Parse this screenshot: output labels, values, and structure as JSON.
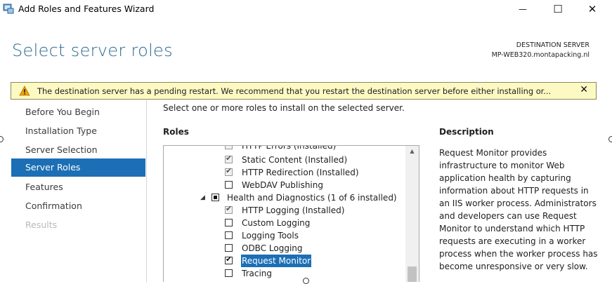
{
  "window": {
    "title": "Add Roles and Features Wizard",
    "minimize_glyph": "—",
    "maximize_glyph": "☐",
    "close_glyph": "✕"
  },
  "header": {
    "page_title": "Select server roles",
    "destination_label": "DESTINATION SERVER",
    "destination_name": "MP-WEB320.montapacking.nl"
  },
  "warning": {
    "icon": "warning-triangle-icon",
    "text": "The destination server has a pending restart. We recommend that you restart the destination server before either installing or...",
    "close_glyph": "✕"
  },
  "nav": {
    "items": [
      {
        "label": "Before You Begin",
        "state": "normal"
      },
      {
        "label": "Installation Type",
        "state": "normal"
      },
      {
        "label": "Server Selection",
        "state": "normal"
      },
      {
        "label": "Server Roles",
        "state": "selected"
      },
      {
        "label": "Features",
        "state": "normal"
      },
      {
        "label": "Confirmation",
        "state": "normal"
      },
      {
        "label": "Results",
        "state": "disabled"
      }
    ]
  },
  "content": {
    "instruction": "Select one or more roles to install on the selected server.",
    "roles_heading": "Roles",
    "description_heading": "Description",
    "description_text": "Request Monitor provides infrastructure to monitor Web application health by capturing information about HTTP requests in an IIS worker process. Administrators and developers can use Request Monitor to understand which HTTP requests are executing in a worker process when the worker process has become unresponsive or very slow."
  },
  "roles_tree": [
    {
      "label": "HTTP Errors (Installed)",
      "state": "installed"
    },
    {
      "label": "Static Content (Installed)",
      "state": "installed"
    },
    {
      "label": "HTTP Redirection (Installed)",
      "state": "installed"
    },
    {
      "label": "WebDAV Publishing",
      "state": "unchecked"
    },
    {
      "label": "Health and Diagnostics (1 of 6 installed)",
      "state": "partial",
      "expander": "◢"
    },
    {
      "label": "HTTP Logging (Installed)",
      "state": "installed"
    },
    {
      "label": "Custom Logging",
      "state": "unchecked"
    },
    {
      "label": "Logging Tools",
      "state": "unchecked"
    },
    {
      "label": "ODBC Logging",
      "state": "unchecked"
    },
    {
      "label": "Request Monitor",
      "state": "checked",
      "selected": true
    },
    {
      "label": "Tracing",
      "state": "unchecked"
    }
  ],
  "colors": {
    "accent": "#1c6fb5",
    "title_blue": "#2b6a8f",
    "warning_bg": "#fcf9c3"
  }
}
